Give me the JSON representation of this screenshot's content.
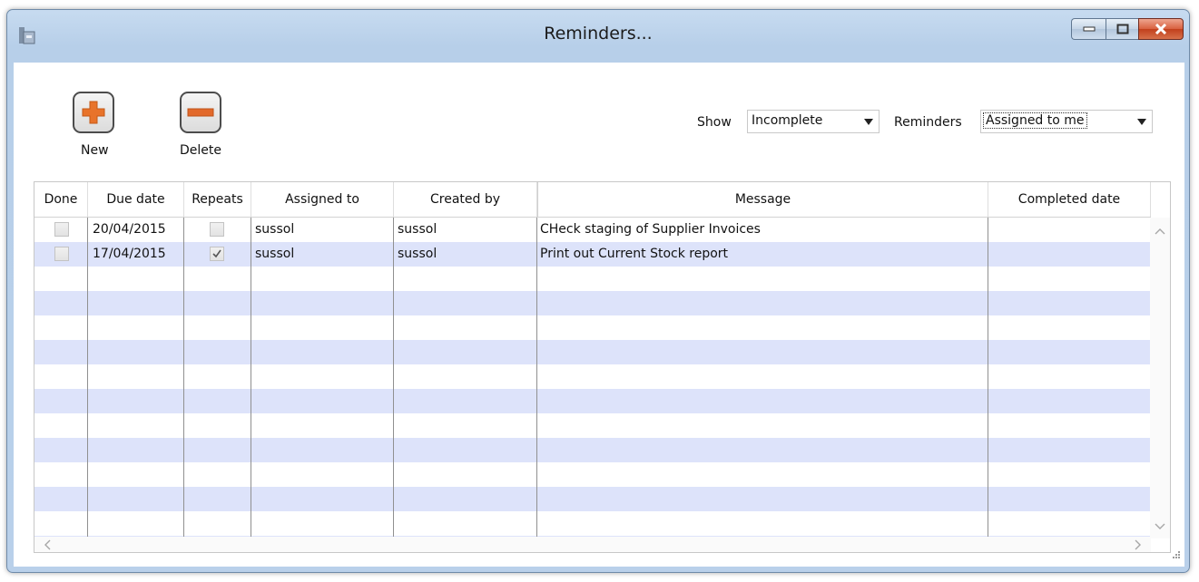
{
  "window": {
    "title": "Reminders..."
  },
  "toolbar": {
    "new_label": "New",
    "delete_label": "Delete"
  },
  "filters": {
    "show_label": "Show",
    "show_value": "Incomplete",
    "reminders_label": "Reminders",
    "reminders_value": "Assigned to me"
  },
  "table": {
    "columns": [
      "Done",
      "Due date",
      "Repeats",
      "Assigned to",
      "Created by",
      "Message",
      "Completed date"
    ],
    "rows": [
      {
        "done": false,
        "due_date": "20/04/2015",
        "repeats": false,
        "assigned_to": "sussol",
        "created_by": "sussol",
        "message": "CHeck staging of Supplier Invoices",
        "completed_date": ""
      },
      {
        "done": false,
        "due_date": "17/04/2015",
        "repeats": true,
        "assigned_to": "sussol",
        "created_by": "sussol",
        "message": "Print out Current Stock report",
        "completed_date": ""
      }
    ]
  },
  "colors": {
    "alt_row": "#dde3fa",
    "accent_new": "#e8732a"
  }
}
